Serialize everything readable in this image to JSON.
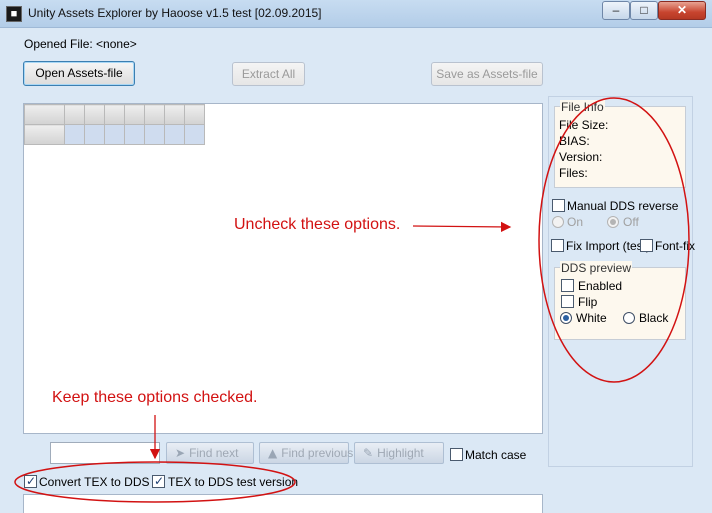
{
  "window": {
    "title": "Unity Assets Explorer by Haoose v1.5 test [02.09.2015]",
    "icon": "unity-app-icon",
    "controls": {
      "minimize": "–",
      "maximize": "□",
      "close": "✕"
    }
  },
  "file": {
    "opened_label": "Opened File: <none>"
  },
  "toolbar": {
    "open_label": "Open Assets-file",
    "extract_label": "Extract All",
    "save_label": "Save as Assets-file"
  },
  "file_info": {
    "title": "File Info",
    "size_label": "File Size:",
    "bias_label": "BIAS:",
    "version_label": "Version:",
    "files_label": "Files:"
  },
  "options": {
    "manual_dds_reverse": {
      "label": "Manual DDS reverse",
      "checked": false
    },
    "reverse_on": {
      "label": "On",
      "selected": false
    },
    "reverse_off": {
      "label": "Off",
      "selected": true
    },
    "fix_import": {
      "label": "Fix Import (test)",
      "checked": false
    },
    "font_fix": {
      "label": "Font-fix",
      "checked": false
    }
  },
  "dds_preview": {
    "title": "DDS preview",
    "enabled": {
      "label": "Enabled",
      "checked": false
    },
    "flip": {
      "label": "Flip",
      "checked": false
    },
    "white": {
      "label": "White",
      "selected": true
    },
    "black": {
      "label": "Black",
      "selected": false
    }
  },
  "search": {
    "input_value": "",
    "find_next_label": "Find next",
    "find_previous_label": "Find previous",
    "highlight_label": "Highlight",
    "match_case_label": "Match case",
    "match_case_checked": false
  },
  "convert": {
    "convert_tex_label": "Convert TEX to DDS",
    "convert_tex_checked": true,
    "tex_test_label": "TEX to DDS test version",
    "tex_test_checked": true
  },
  "annotations": {
    "uncheck_note": "Uncheck these options.",
    "keep_note": "Keep these options checked.",
    "color": "#d21212"
  },
  "colors": {
    "window_bg": "#dbe8f5",
    "groupbox_bg": "#fdf8ee",
    "annotation": "#d21212"
  }
}
